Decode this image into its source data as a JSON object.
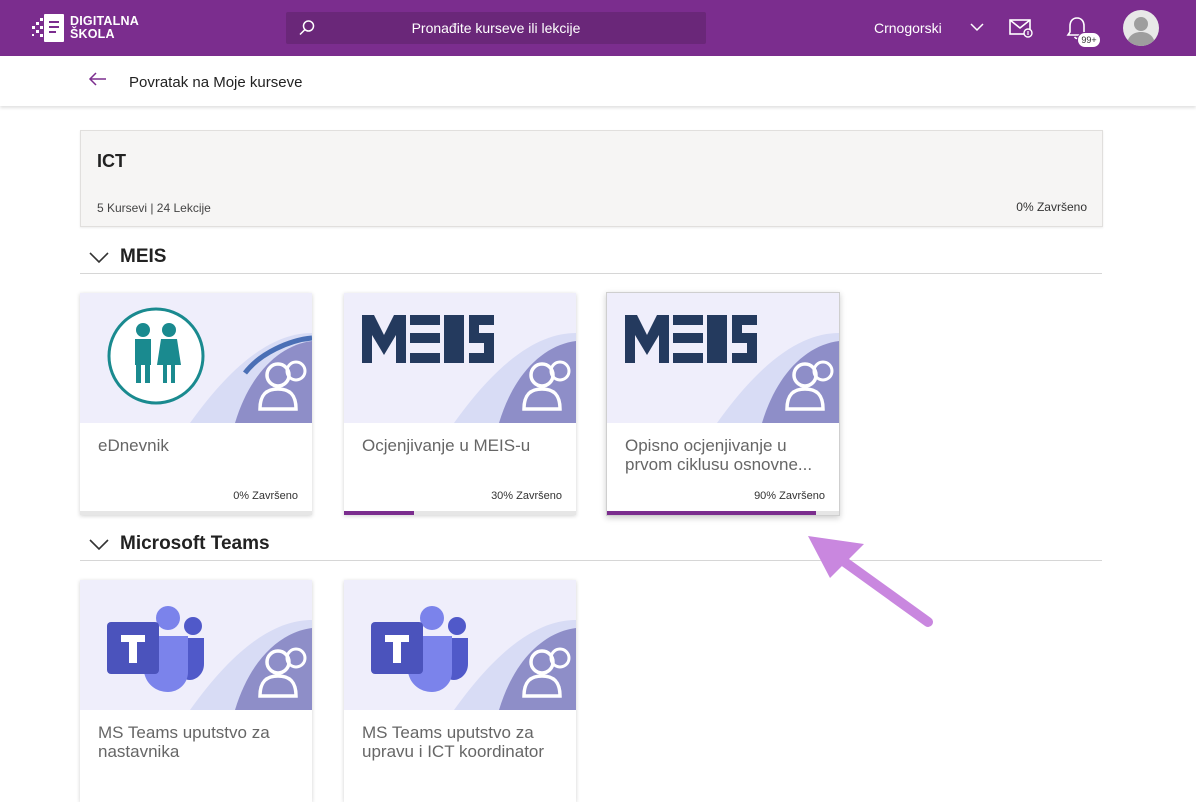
{
  "header": {
    "logo_line1": "DIGITALNA",
    "logo_line2": "ŠKOLA",
    "search_placeholder": "Pronađite kurseve ili lekcije",
    "language": "Crnogorski",
    "notification_count": "99+",
    "icons": [
      "search-icon",
      "chevron-down-icon",
      "mail-icon",
      "bell-icon",
      "avatar"
    ],
    "colors": {
      "brand": "#7b2d8e",
      "search_bg": "#6a2779"
    }
  },
  "back": {
    "label": "Povratak na Moje kurseve",
    "icon": "arrow-left-icon"
  },
  "course": {
    "title": "ICT",
    "meta": "5 Kursevi | 24 Lekcije",
    "progress": "0% Završeno"
  },
  "sections": [
    {
      "name": "MEIS",
      "cards": [
        {
          "title": "eDnevnik",
          "progress_label": "0% Završeno",
          "progress": 0.0,
          "thumb": "students-icon"
        },
        {
          "title": "Ocjenjivanje u MEIS-u",
          "progress_label": "30% Završeno",
          "progress": 0.3,
          "thumb": "meis-logo"
        },
        {
          "title": "Opisno ocjenjivanje u prvom ciklusu osnovne...",
          "progress_label": "90% Završeno",
          "progress": 0.9,
          "thumb": "meis-logo"
        }
      ]
    },
    {
      "name": "Microsoft Teams",
      "cards": [
        {
          "title": "MS Teams uputstvo za nastavnika",
          "thumb": "teams-logo"
        },
        {
          "title": "MS Teams uputstvo za upravu i ICT koordinator",
          "thumb": "teams-logo"
        }
      ]
    }
  ]
}
